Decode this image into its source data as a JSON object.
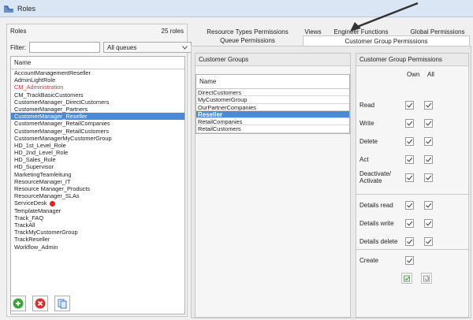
{
  "window": {
    "title": "Roles"
  },
  "left_panel": {
    "header": "Roles",
    "count": "25 roles",
    "filter_label": "Filter:",
    "filter_value": "",
    "queue_select": "All queues",
    "list_header": "Name",
    "roles": [
      "AccountManagementReseller",
      "AdminLightRole",
      "CM_Administration",
      "CM_TrackBasicCustomers",
      "CustomerManager_DirectCustomers",
      "CustomerManager_Partners",
      "CustomerManager_Reseller",
      "CustomerManager_RetailCompanies",
      "CustomerManager_RetailCustomers",
      "CustomerManagerMyCustomerGroup",
      "HD_1st_Level_Role",
      "HD_2nd_Level_Role",
      "HD_Sales_Role",
      "HD_Supervisor",
      "MarketingTeamleitung",
      "ResourceManager_IT",
      "Resource Manager_Products",
      "ResourceManager_SLAs",
      "ServiceDesk",
      "TemplateManager",
      "Track_FAQ",
      "TrackAll",
      "TrackMyCustomerGroup",
      "TrackReseller",
      "Workflow_Admin"
    ],
    "selected_index": 6,
    "red_indices": [
      2
    ],
    "dot_indices": [
      18
    ]
  },
  "tabs": {
    "row1": [
      "Resource Types Permissions",
      "Views",
      "Engineer Functions",
      "Global Permissions"
    ],
    "row2": [
      "Queue Permissions",
      "Customer Group Permissions"
    ],
    "active": "Customer Group Permissions"
  },
  "customer_groups": {
    "header": "Customer Groups",
    "name_header": "Name",
    "items": [
      "DirectCustomers",
      "MyCustomerGroup",
      "OurPartnerCompanies",
      "Reseller",
      "RetailCompanies",
      "RetailCustomers"
    ],
    "selected_index": 3
  },
  "permissions": {
    "header": "Customer Group Permissions",
    "col_own": "Own",
    "col_all": "All",
    "rows": [
      {
        "label": "Read",
        "own": true,
        "all": true
      },
      {
        "label": "Write",
        "own": true,
        "all": true
      },
      {
        "label": "Delete",
        "own": true,
        "all": true
      },
      {
        "label": "Act",
        "own": true,
        "all": true
      },
      {
        "label": "Deactivate/ Activate",
        "own": true,
        "all": true
      },
      {
        "label": "Details read",
        "own": true,
        "all": true
      },
      {
        "label": "Details write",
        "own": true,
        "all": true
      },
      {
        "label": "Details delete",
        "own": true,
        "all": true
      },
      {
        "label": "Create",
        "own": true,
        "all": null
      }
    ]
  },
  "colors": {
    "selection": "#4a8ad8",
    "red_text": "#e53030",
    "add_green": "#3aa53a",
    "delete_red": "#d83030"
  }
}
